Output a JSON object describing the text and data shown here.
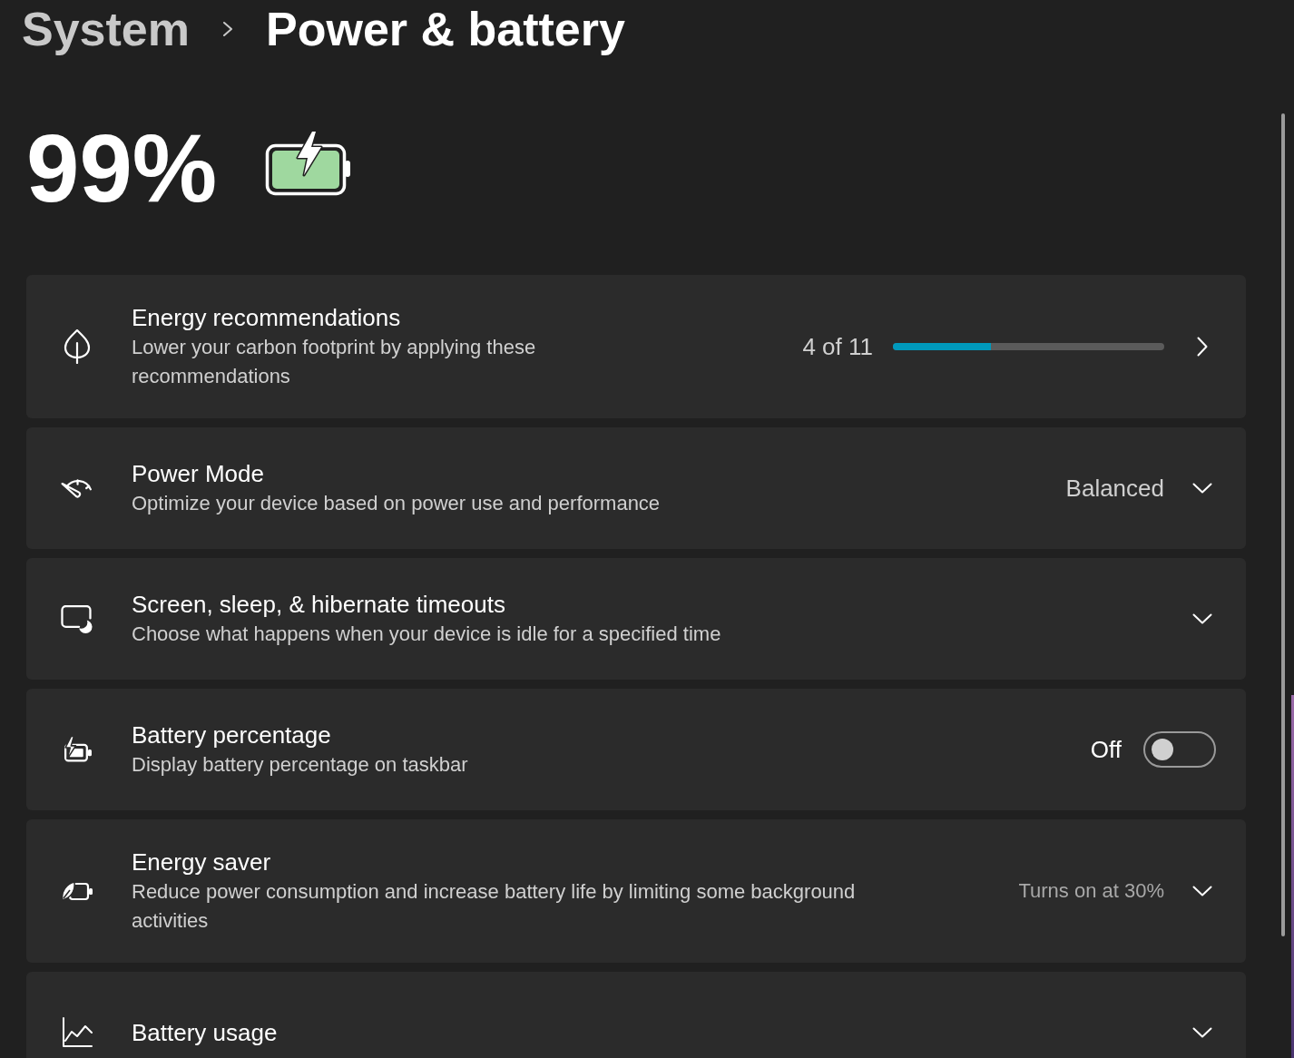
{
  "breadcrumb": [
    {
      "label": "System",
      "current": false
    },
    {
      "label": "Power & battery",
      "current": true
    }
  ],
  "battery": {
    "percentage": "99%",
    "charging": true
  },
  "settings": [
    {
      "kind": "progress",
      "title": "Energy recommendations",
      "description": "Lower your carbon footprint by applying these recommendations",
      "progress_text": "4 of 11",
      "level": 0.36
    },
    {
      "kind": "dropdown",
      "title": "Power Mode",
      "description": "Optimize your device based on power use and performance",
      "value": "Balanced"
    },
    {
      "kind": "expander",
      "title": "Screen, sleep, & hibernate timeouts",
      "description": "Choose what happens when your device is idle for a specified time"
    },
    {
      "kind": "toggle",
      "title": "Battery percentage",
      "description": "Display battery percentage on taskbar",
      "state_label": "Off",
      "on": false
    },
    {
      "kind": "expander",
      "title": "Energy saver",
      "description": "Reduce power consumption and increase battery life by limiting some background activities",
      "summary": "Turns on at 30%"
    },
    {
      "kind": "expander",
      "title": "Battery usage"
    }
  ]
}
